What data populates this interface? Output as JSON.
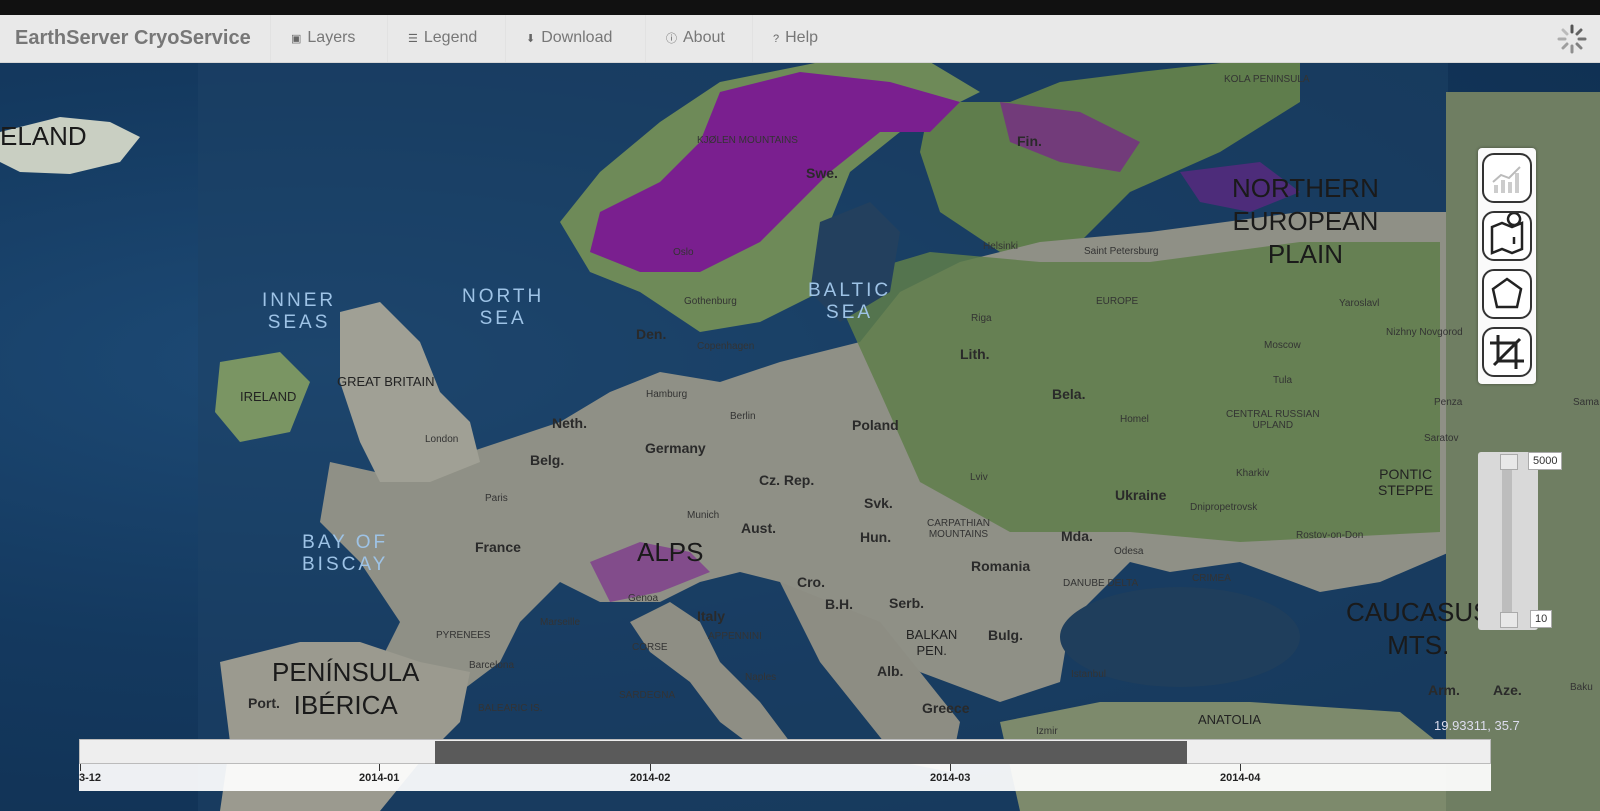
{
  "app": {
    "title": "EarthServer CryoService"
  },
  "nav": [
    {
      "label": "Layers",
      "icon": "image-icon"
    },
    {
      "label": "Legend",
      "icon": "list-icon"
    },
    {
      "label": "Download",
      "icon": "download-icon"
    },
    {
      "label": "About",
      "icon": "info-circle-icon"
    },
    {
      "label": "Help",
      "icon": "question-circle-icon"
    }
  ],
  "map": {
    "labels": {
      "eland": "ELAND",
      "inner_seas": "INNER\nSEAS",
      "north_sea": "NORTH\nSEA",
      "baltic_sea": "BALTIC\nSEA",
      "bay_biscay": "BAY OF\nBISCAY",
      "iberia": "PENÍNSULA\nIBÉRICA",
      "alps": "ALPS",
      "nep": "NORTHERN\nEUROPEAN\nPLAIN",
      "caucasus": "CAUCASUS\nMTS.",
      "pontic": "PONTIC\nSTEPPE",
      "kola": "KOLA PENINSULA",
      "kjolen": "KJØLEN MOUNTAINS",
      "swe": "Swe.",
      "fin": "Fin.",
      "oslo": "Oslo",
      "helsinki": "Helsinki",
      "stpete": "Saint Petersburg",
      "gothenburg": "Gothenburg",
      "den": "Den.",
      "copenhagen": "Copenhagen",
      "europe": "EUROPE",
      "yaroslavl": "Yaroslavl",
      "nizhny": "Nizhny Novgorod",
      "riga": "Riga",
      "lith": "Lith.",
      "moscow": "Moscow",
      "ireland": "IRELAND",
      "gb": "GREAT BRITAIN",
      "hamburg": "Hamburg",
      "bela": "Bela.",
      "tula": "Tula",
      "london": "London",
      "neth": "Neth.",
      "berlin": "Berlin",
      "poland": "Poland",
      "homel": "Homel",
      "crupland": "CENTRAL RUSSIAN\nUPLAND",
      "penza": "Penza",
      "sama": "Sama",
      "saratov": "Saratov",
      "germany": "Germany",
      "belg": "Belg.",
      "kharkiv": "Kharkiv",
      "czrep": "Cz. Rep.",
      "lviv": "Lviv",
      "ukraine": "Ukraine",
      "paris": "Paris",
      "svk": "Svk.",
      "dnipro": "Dnipropetrovsk",
      "munich": "Munich",
      "aust": "Aust.",
      "carpathian": "CARPATHIAN\nMOUNTAINS",
      "rostov": "Rostov-on-Don",
      "france": "France",
      "hun": "Hun.",
      "mda": "Mda.",
      "odesa": "Odesa",
      "romania": "Romania",
      "cro": "Cro.",
      "danube": "DANUBE DELTA",
      "crimea": "CRIMEA",
      "genoa": "Genoa",
      "italy": "Italy",
      "bh": "B.H.",
      "serb": "Serb.",
      "marseille": "Marseille",
      "pyrenees": "PYRENEES",
      "corse": "CORSE",
      "appennini": "APPENNINI",
      "balkan": "BALKAN\nPEN.",
      "bulg": "Bulg.",
      "barcelona": "Barcelona",
      "alb": "Alb.",
      "naples": "Naples",
      "istanbul": "Istanbul",
      "port": "Port.",
      "sardegna": "SARDEGNA",
      "balearic": "BALEARIC IS.",
      "greece": "Greece",
      "anatolia": "ANATOLIA",
      "izmir": "Izmir",
      "arm": "Arm.",
      "aze": "Aze.",
      "baku": "Baku"
    }
  },
  "elevation_slider": {
    "max": "5000",
    "min": "10"
  },
  "cursor_coords": "19.93311, 35.7",
  "timeline": {
    "labels": [
      "3-12",
      "2014-01",
      "2014-02",
      "2014-03",
      "2014-04"
    ]
  }
}
